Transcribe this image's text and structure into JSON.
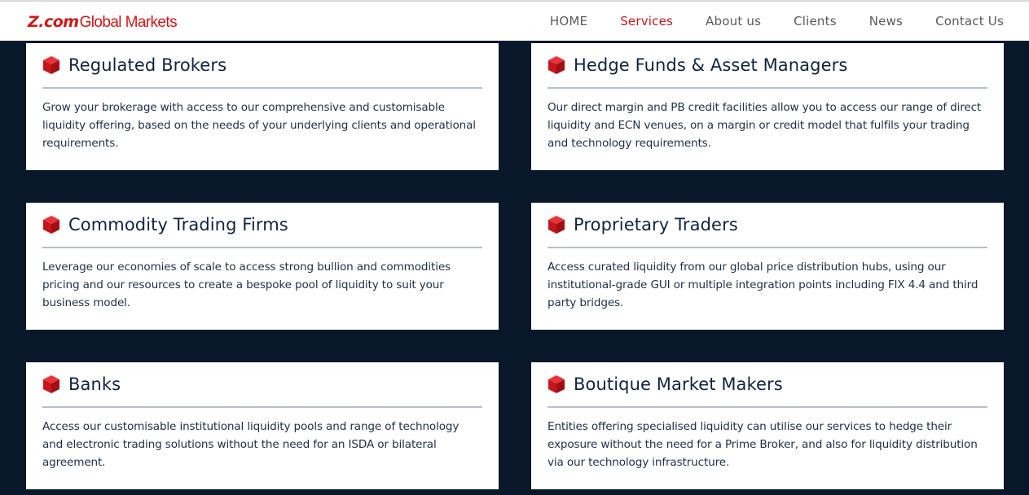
{
  "brand": {
    "name_z": "Z.com",
    "name_rest": "Global Markets"
  },
  "nav": {
    "items": [
      {
        "label": "HOME",
        "active": false
      },
      {
        "label": "Services",
        "active": true
      },
      {
        "label": "About us",
        "active": false
      },
      {
        "label": "Clients",
        "active": false
      },
      {
        "label": "News",
        "active": false
      },
      {
        "label": "Contact Us",
        "active": false
      }
    ]
  },
  "colors": {
    "accent": "#c0191f",
    "background": "#08182a",
    "card": "#ffffff",
    "title": "#12233b"
  },
  "services": [
    {
      "title": "Regulated Brokers",
      "icon": "red-cube-icon",
      "text": "Grow your brokerage with access to our comprehensive and customisable liquidity offering, based on the needs of your underlying clients and operational requirements."
    },
    {
      "title": "Hedge Funds & Asset Managers",
      "icon": "red-cube-icon",
      "text": "Our direct margin and PB credit facilities allow you to access our range of direct liquidity and ECN venues, on a margin or credit model that fulfils your trading and technology requirements."
    },
    {
      "title": "Commodity Trading Firms",
      "icon": "red-cube-icon",
      "text": "Leverage our economies of scale to access strong bullion and commodities pricing and our resources to create a bespoke pool of liquidity to suit your business model."
    },
    {
      "title": "Proprietary Traders",
      "icon": "red-cube-icon",
      "text": "Access curated liquidity from our global price distribution hubs, using our institutional-grade GUI or multiple integration points including FIX 4.4 and third party bridges."
    },
    {
      "title": "Banks",
      "icon": "red-cube-icon",
      "text": "Access our customisable institutional liquidity pools and range of technology and electronic trading solutions without the need for an ISDA or bilateral agreement."
    },
    {
      "title": "Boutique Market Makers",
      "icon": "red-cube-icon",
      "text": "Entities offering specialised liquidity can utilise our services to hedge their exposure without the need for a Prime Broker, and also for liquidity distribution via our technology infrastructure."
    }
  ]
}
